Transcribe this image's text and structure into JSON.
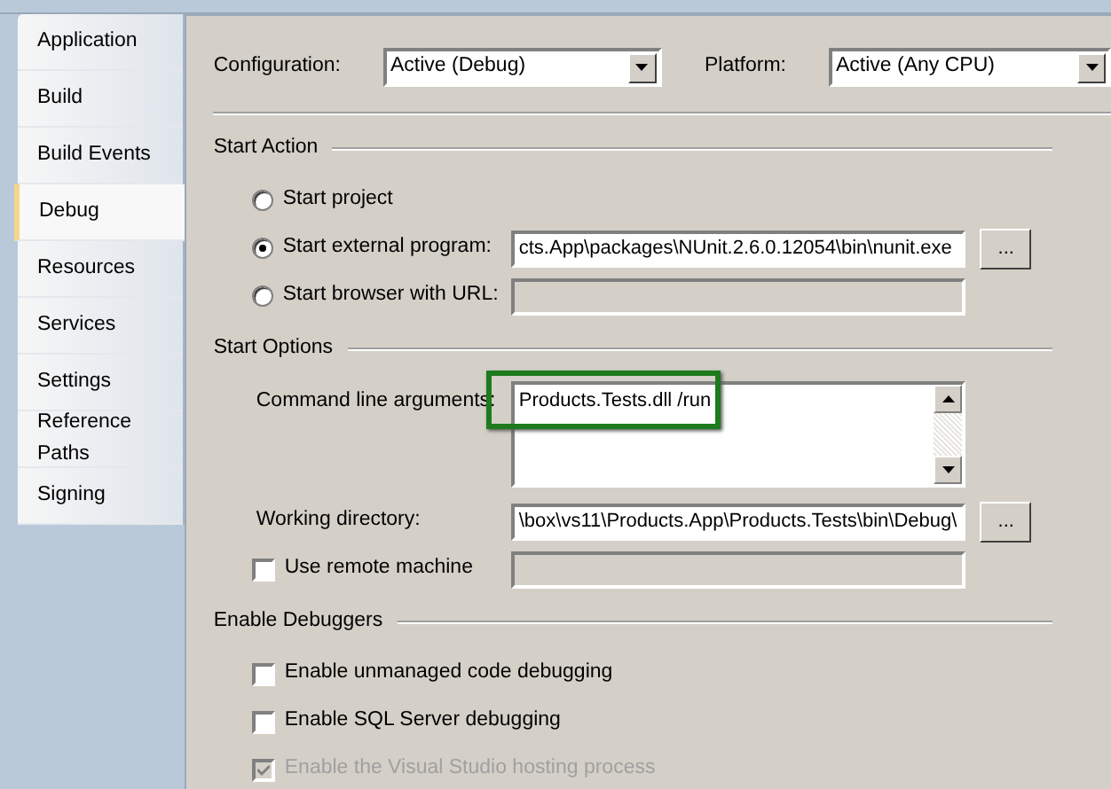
{
  "sidebar": {
    "items": [
      {
        "label": "Application",
        "selected": false
      },
      {
        "label": "Build",
        "selected": false
      },
      {
        "label": "Build Events",
        "selected": false
      },
      {
        "label": "Debug",
        "selected": true
      },
      {
        "label": "Resources",
        "selected": false
      },
      {
        "label": "Services",
        "selected": false
      },
      {
        "label": "Settings",
        "selected": false
      },
      {
        "label": "Reference Paths",
        "selected": false
      },
      {
        "label": "Signing",
        "selected": false
      }
    ]
  },
  "configuration": {
    "label": "Configuration:",
    "value": "Active (Debug)"
  },
  "platform": {
    "label": "Platform:",
    "value": "Active (Any CPU)"
  },
  "sections": [
    {
      "title": "Start Action",
      "rows": [
        {
          "kind": "radio",
          "label": "Start project",
          "selected": false
        },
        {
          "kind": "radio",
          "label": "Start external program:",
          "selected": true,
          "field": {
            "value": "cts.App\\packages\\NUnit.2.6.0.12054\\bin\\nunit.exe",
            "enabled": true
          },
          "browse": "..."
        },
        {
          "kind": "radio",
          "label": "Start browser with URL:",
          "selected": false,
          "field": {
            "enabled": false
          }
        }
      ]
    },
    {
      "title": "Start Options",
      "rows": [
        {
          "kind": "textarea",
          "label": "Command line arguments:",
          "highlight": true,
          "field": {
            "value": "Products.Tests.dll /run",
            "enabled": true
          }
        },
        {
          "kind": "text",
          "label": "Working directory:",
          "field": {
            "value": "\\box\\vs11\\Products.App\\Products.Tests\\bin\\Debug\\",
            "enabled": true
          },
          "browse": "..."
        },
        {
          "kind": "checkbox",
          "label": "Use remote machine",
          "checked": false,
          "disabled": false,
          "field": {
            "enabled": false
          }
        }
      ]
    },
    {
      "title": "Enable Debuggers",
      "rows": [
        {
          "kind": "checkbox",
          "label": "Enable unmanaged code debugging",
          "checked": false,
          "disabled": false
        },
        {
          "kind": "checkbox",
          "label": "Enable SQL Server debugging",
          "checked": false,
          "disabled": false
        },
        {
          "kind": "checkbox",
          "label": "Enable the Visual Studio hosting process",
          "checked": true,
          "disabled": true
        }
      ]
    }
  ]
}
